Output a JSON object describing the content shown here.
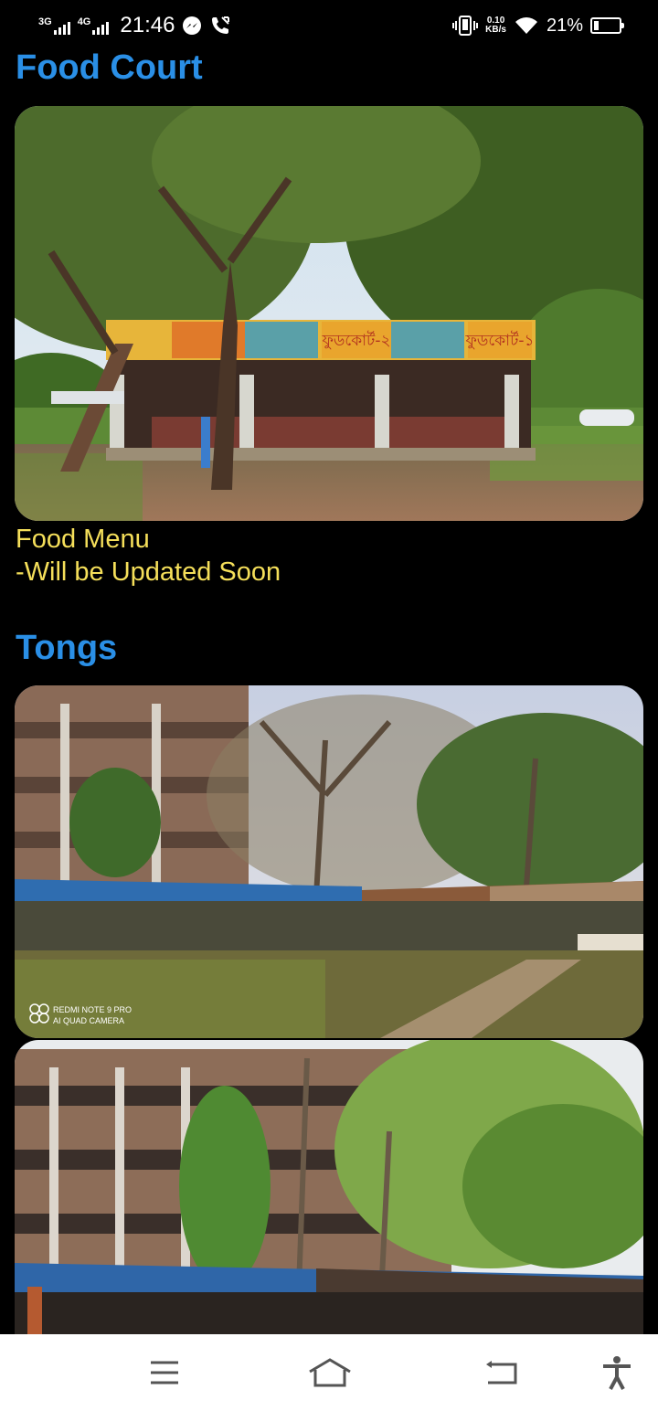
{
  "status_bar": {
    "network1": "3G",
    "network2": "4G",
    "time": "21:46",
    "speed_value": "0.10",
    "speed_unit": "KB/s",
    "battery_percent": "21%",
    "battery_level": 0.21
  },
  "sections": {
    "food_court": {
      "title": "Food Court",
      "menu_line1": "Food Menu",
      "menu_line2": "-Will be Updated Soon"
    },
    "tongs": {
      "title": "Tongs",
      "watermark_line1": "REDMI NOTE 9 PRO",
      "watermark_line2": "AI QUAD CAMERA"
    }
  },
  "food_court_sign": {
    "sign_text_1": "ফুডকোর্ট-২",
    "sign_text_2": "ফুডকোর্ট-১"
  },
  "nav": {
    "icons": [
      "menu-icon",
      "home-icon",
      "back-icon",
      "accessibility-icon"
    ]
  }
}
